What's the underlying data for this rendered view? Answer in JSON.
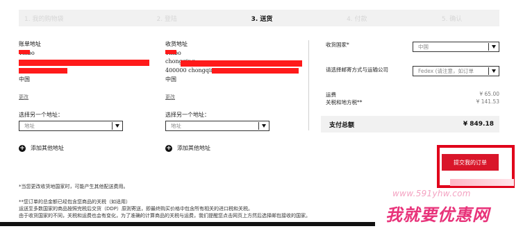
{
  "steps": [
    {
      "label": "1. 我的购物袋",
      "active": false
    },
    {
      "label": "2. 登陆",
      "active": false
    },
    {
      "label": "3. 送货",
      "active": true
    },
    {
      "label": "4. 付款",
      "active": false
    },
    {
      "label": "5. 确认",
      "active": false
    }
  ],
  "billing": {
    "title": "账单地址",
    "name": "Yinbo",
    "country": "中国",
    "change_link": "更改",
    "select_label": "选择另一个地址：",
    "select_value": "地址",
    "add_label": "添加其他地址"
  },
  "shipping": {
    "title": "收货地址",
    "name": "Yinbo",
    "city": "chongqing",
    "postcode_city": "400000 chongqing",
    "country": "中国",
    "change_link": "更改",
    "select_label": "选择另一个地址：",
    "select_value": "地址",
    "add_label": "添加其他地址"
  },
  "order": {
    "country_label": "收货国家*",
    "country_value": "中国",
    "shipping_method_label": "请选择邮寄方式与运输公司",
    "shipping_method_value": "Fedex (请注意，如订单",
    "fee_label": "运费",
    "fee_value": "¥ 65.00",
    "duty_label": "关税和地方税**",
    "duty_value": "¥ 141.53",
    "total_label": "支付总额",
    "total_value": "¥ 849.18",
    "submit_label": "提交我的订单"
  },
  "notes": {
    "line1": "*当您更改收货地国家时，可能产生其他配送费用。",
    "line2": "**您订单的总金额已经包含您商品的关税（如适用）",
    "line3": "运送至多数国家的商品按照完税后交货（DDP）原则寄送，即最终购买价格中包含所有相关的进口税和关税。",
    "line4": "由于收货国家的不同，关税和运费也会有变化，为了准确的计算商品的关税与运费，我们提醒您点击网页上方然后选择邮包接收的国家。"
  },
  "watermark": {
    "url": "www.591yhw.com",
    "text": "我就要优惠网"
  },
  "colors": {
    "accent_red": "#d9162a",
    "highlight_frame": "#e0001a",
    "redaction": "#ff1a1a",
    "watermark_pink": "#e8337a"
  }
}
